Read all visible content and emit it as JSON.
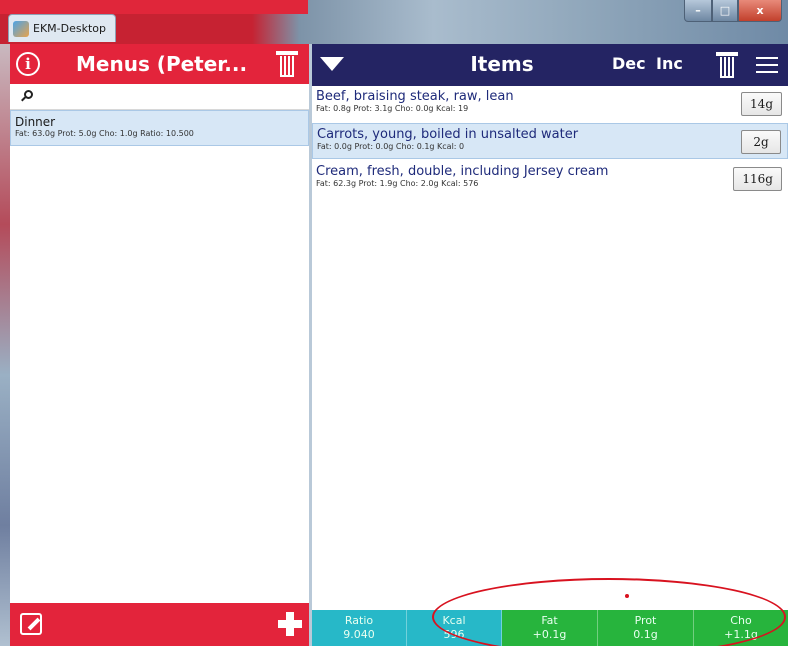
{
  "window": {
    "title": "EKM-Desktop",
    "controls": {
      "minimize": "–",
      "maximize": "□",
      "close": "x"
    }
  },
  "menus_panel": {
    "title": "Menus (Peter...",
    "search": {
      "value": "",
      "placeholder": ""
    },
    "items": [
      {
        "name": "Dinner",
        "detail": "Fat: 63.0g Prot: 5.0g Cho: 1.0g Ratio: 10.500",
        "selected": true
      }
    ]
  },
  "items_panel": {
    "title": "Items",
    "dec_label": "Dec",
    "inc_label": "Inc",
    "items": [
      {
        "name": "Beef, braising steak, raw, lean",
        "detail": "Fat: 0.8g Prot: 3.1g Cho: 0.0g Kcal: 19",
        "quantity": "14g",
        "selected": false
      },
      {
        "name": "Carrots, young, boiled in unsalted water",
        "detail": "Fat: 0.0g Prot: 0.0g Cho: 0.1g Kcal: 0",
        "quantity": "2g",
        "selected": true
      },
      {
        "name": "Cream, fresh, double, including Jersey cream",
        "detail": "Fat: 62.3g Prot: 1.9g Cho: 2.0g Kcal: 576",
        "quantity": "116g",
        "selected": false
      }
    ]
  },
  "stats": {
    "ratio": {
      "label": "Ratio",
      "value": "9.040"
    },
    "kcal": {
      "label": "Kcal",
      "value": "596"
    },
    "fat": {
      "label": "Fat",
      "value": "+0.1g"
    },
    "prot": {
      "label": "Prot",
      "value": "0.1g"
    },
    "cho": {
      "label": "Cho",
      "value": "+1.1g"
    }
  },
  "colors": {
    "menus_header": "#e3243b",
    "items_header": "#242463",
    "selection": "#d7e7f6",
    "stat_cyan": "#27b8c8",
    "stat_green": "#27b43d",
    "annotation": "#d8121f"
  },
  "icons": {
    "info": "info-icon",
    "delete": "trash-icon",
    "dropdown": "dropdown-icon",
    "menu": "hamburger-icon",
    "edit": "edit-icon",
    "add": "add-icon",
    "search": "search-icon"
  }
}
